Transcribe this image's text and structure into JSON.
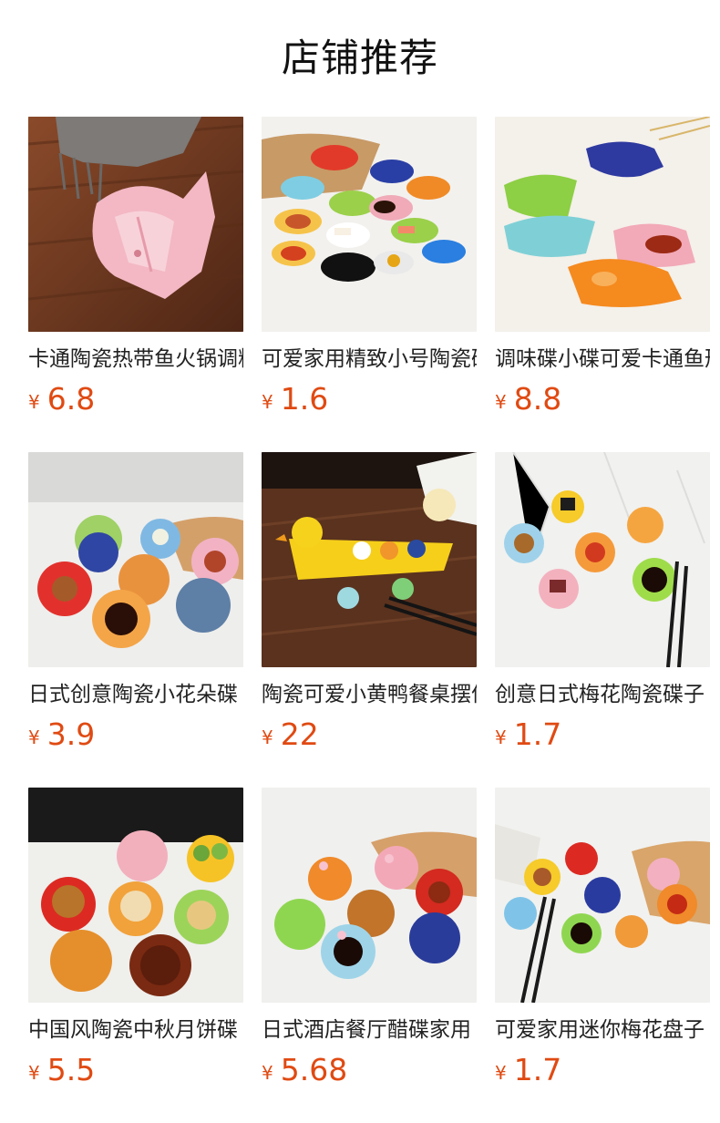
{
  "page": {
    "title": "店铺推荐"
  },
  "products": [
    {
      "name": "卡通陶瓷热带鱼火锅调料碟",
      "currency": "¥",
      "price": "6.8",
      "scene": "fish-dish-wood"
    },
    {
      "name": "可爱家用精致小号陶瓷碟",
      "currency": "¥",
      "price": "1.6",
      "scene": "leaf-dishes"
    },
    {
      "name": "调味碟小碟可爱卡通鱼形",
      "currency": "¥",
      "price": "8.8",
      "scene": "fish-dishes-colorful"
    },
    {
      "name": "日式创意陶瓷小花朵碟",
      "currency": "¥",
      "price": "3.9",
      "scene": "flower-dishes"
    },
    {
      "name": "陶瓷可爱小黄鸭餐桌摆件",
      "currency": "¥",
      "price": "22",
      "scene": "duck-boat"
    },
    {
      "name": "创意日式梅花陶瓷碟子",
      "currency": "¥",
      "price": "1.7",
      "scene": "plum-dishes"
    },
    {
      "name": "中国风陶瓷中秋月饼碟",
      "currency": "¥",
      "price": "5.5",
      "scene": "mooncake-dishes"
    },
    {
      "name": "日式酒店餐厅醋碟家用",
      "currency": "¥",
      "price": "5.68",
      "scene": "flower-bowls"
    },
    {
      "name": "可爱家用迷你梅花盘子",
      "currency": "¥",
      "price": "1.7",
      "scene": "mini-plum"
    }
  ]
}
